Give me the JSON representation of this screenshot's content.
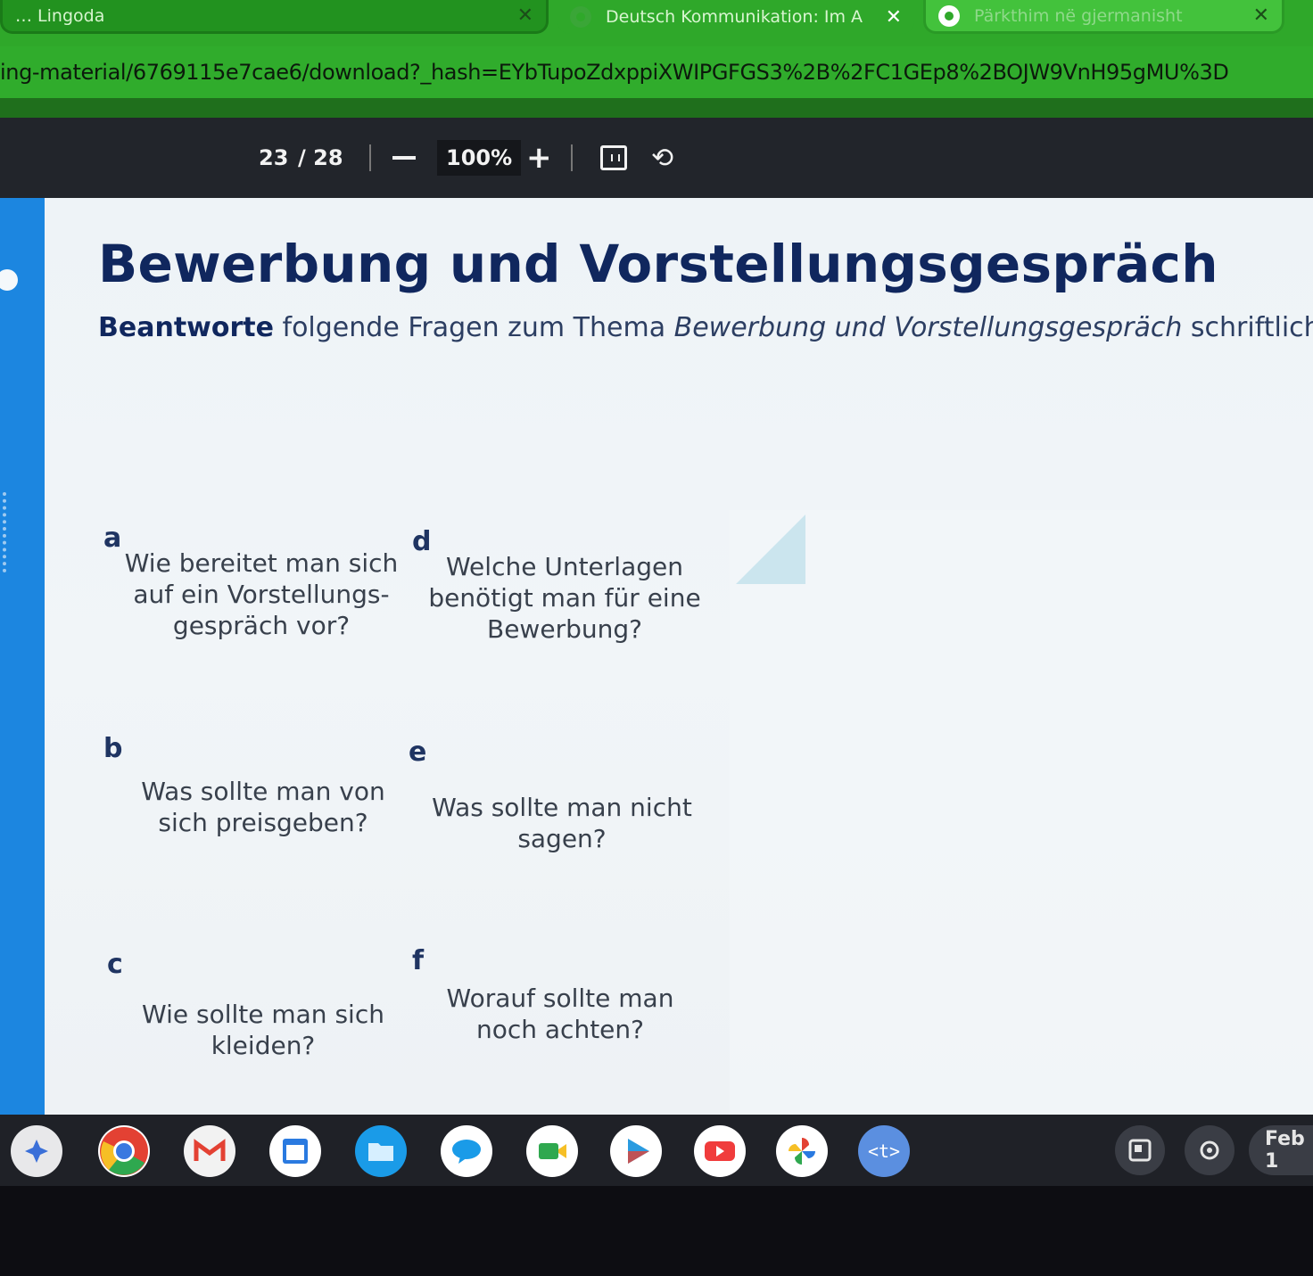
{
  "browser": {
    "tabs": [
      {
        "title": "… Lingoda",
        "active": false
      },
      {
        "title": "Deutsch Kommunikation: Im A",
        "active": true
      },
      {
        "title": "Pärkthim në gjermanisht",
        "active": false
      }
    ],
    "url": "ing-material/6769115e7cae6/download?_hash=EYbTupoZdxppiXWIPGFGS3%2B%2FC1GEp8%2BOJW9VnH95gMU%3D"
  },
  "pdf_toolbar": {
    "page_current": "23",
    "page_total": "/ 28",
    "zoom": "100%",
    "zoom_in_label": "+"
  },
  "document": {
    "title": "Bewerbung und Vorstellungsgespräch",
    "instruction": {
      "bold": "Beantworte",
      "text1": "folgende Fragen zum Thema",
      "italic": "Bewerbung und Vorstellungsgespräch",
      "text2": "schriftlich!"
    },
    "questions": [
      {
        "letter": "a",
        "text": "Wie bereitet man sich auf ein Vorstellungs-gespräch vor?"
      },
      {
        "letter": "b",
        "text": "Was sollte man von sich preisgeben?"
      },
      {
        "letter": "c",
        "text": "Wie sollte man sich kleiden?"
      },
      {
        "letter": "d",
        "text": "Welche Unterlagen benötigt man für eine Bewerbung?"
      },
      {
        "letter": "e",
        "text": "Was sollte man nicht sagen?"
      },
      {
        "letter": "f",
        "text": "Worauf sollte man noch achten?"
      }
    ]
  },
  "shelf": {
    "apps": [
      "launcher-icon",
      "chrome-icon",
      "gmail-icon",
      "calendar-icon",
      "files-icon",
      "messages-icon",
      "meet-icon",
      "play-store-icon",
      "youtube-icon",
      "photos-icon",
      "code-icon"
    ],
    "date": "Feb 1",
    "colors": {
      "chrome": "#e34133",
      "gmail": "#ffffff",
      "files": "#1a9be8",
      "messages": "#1a9be8",
      "youtube": "#f03c3c",
      "code": "#5b8fe0"
    }
  }
}
